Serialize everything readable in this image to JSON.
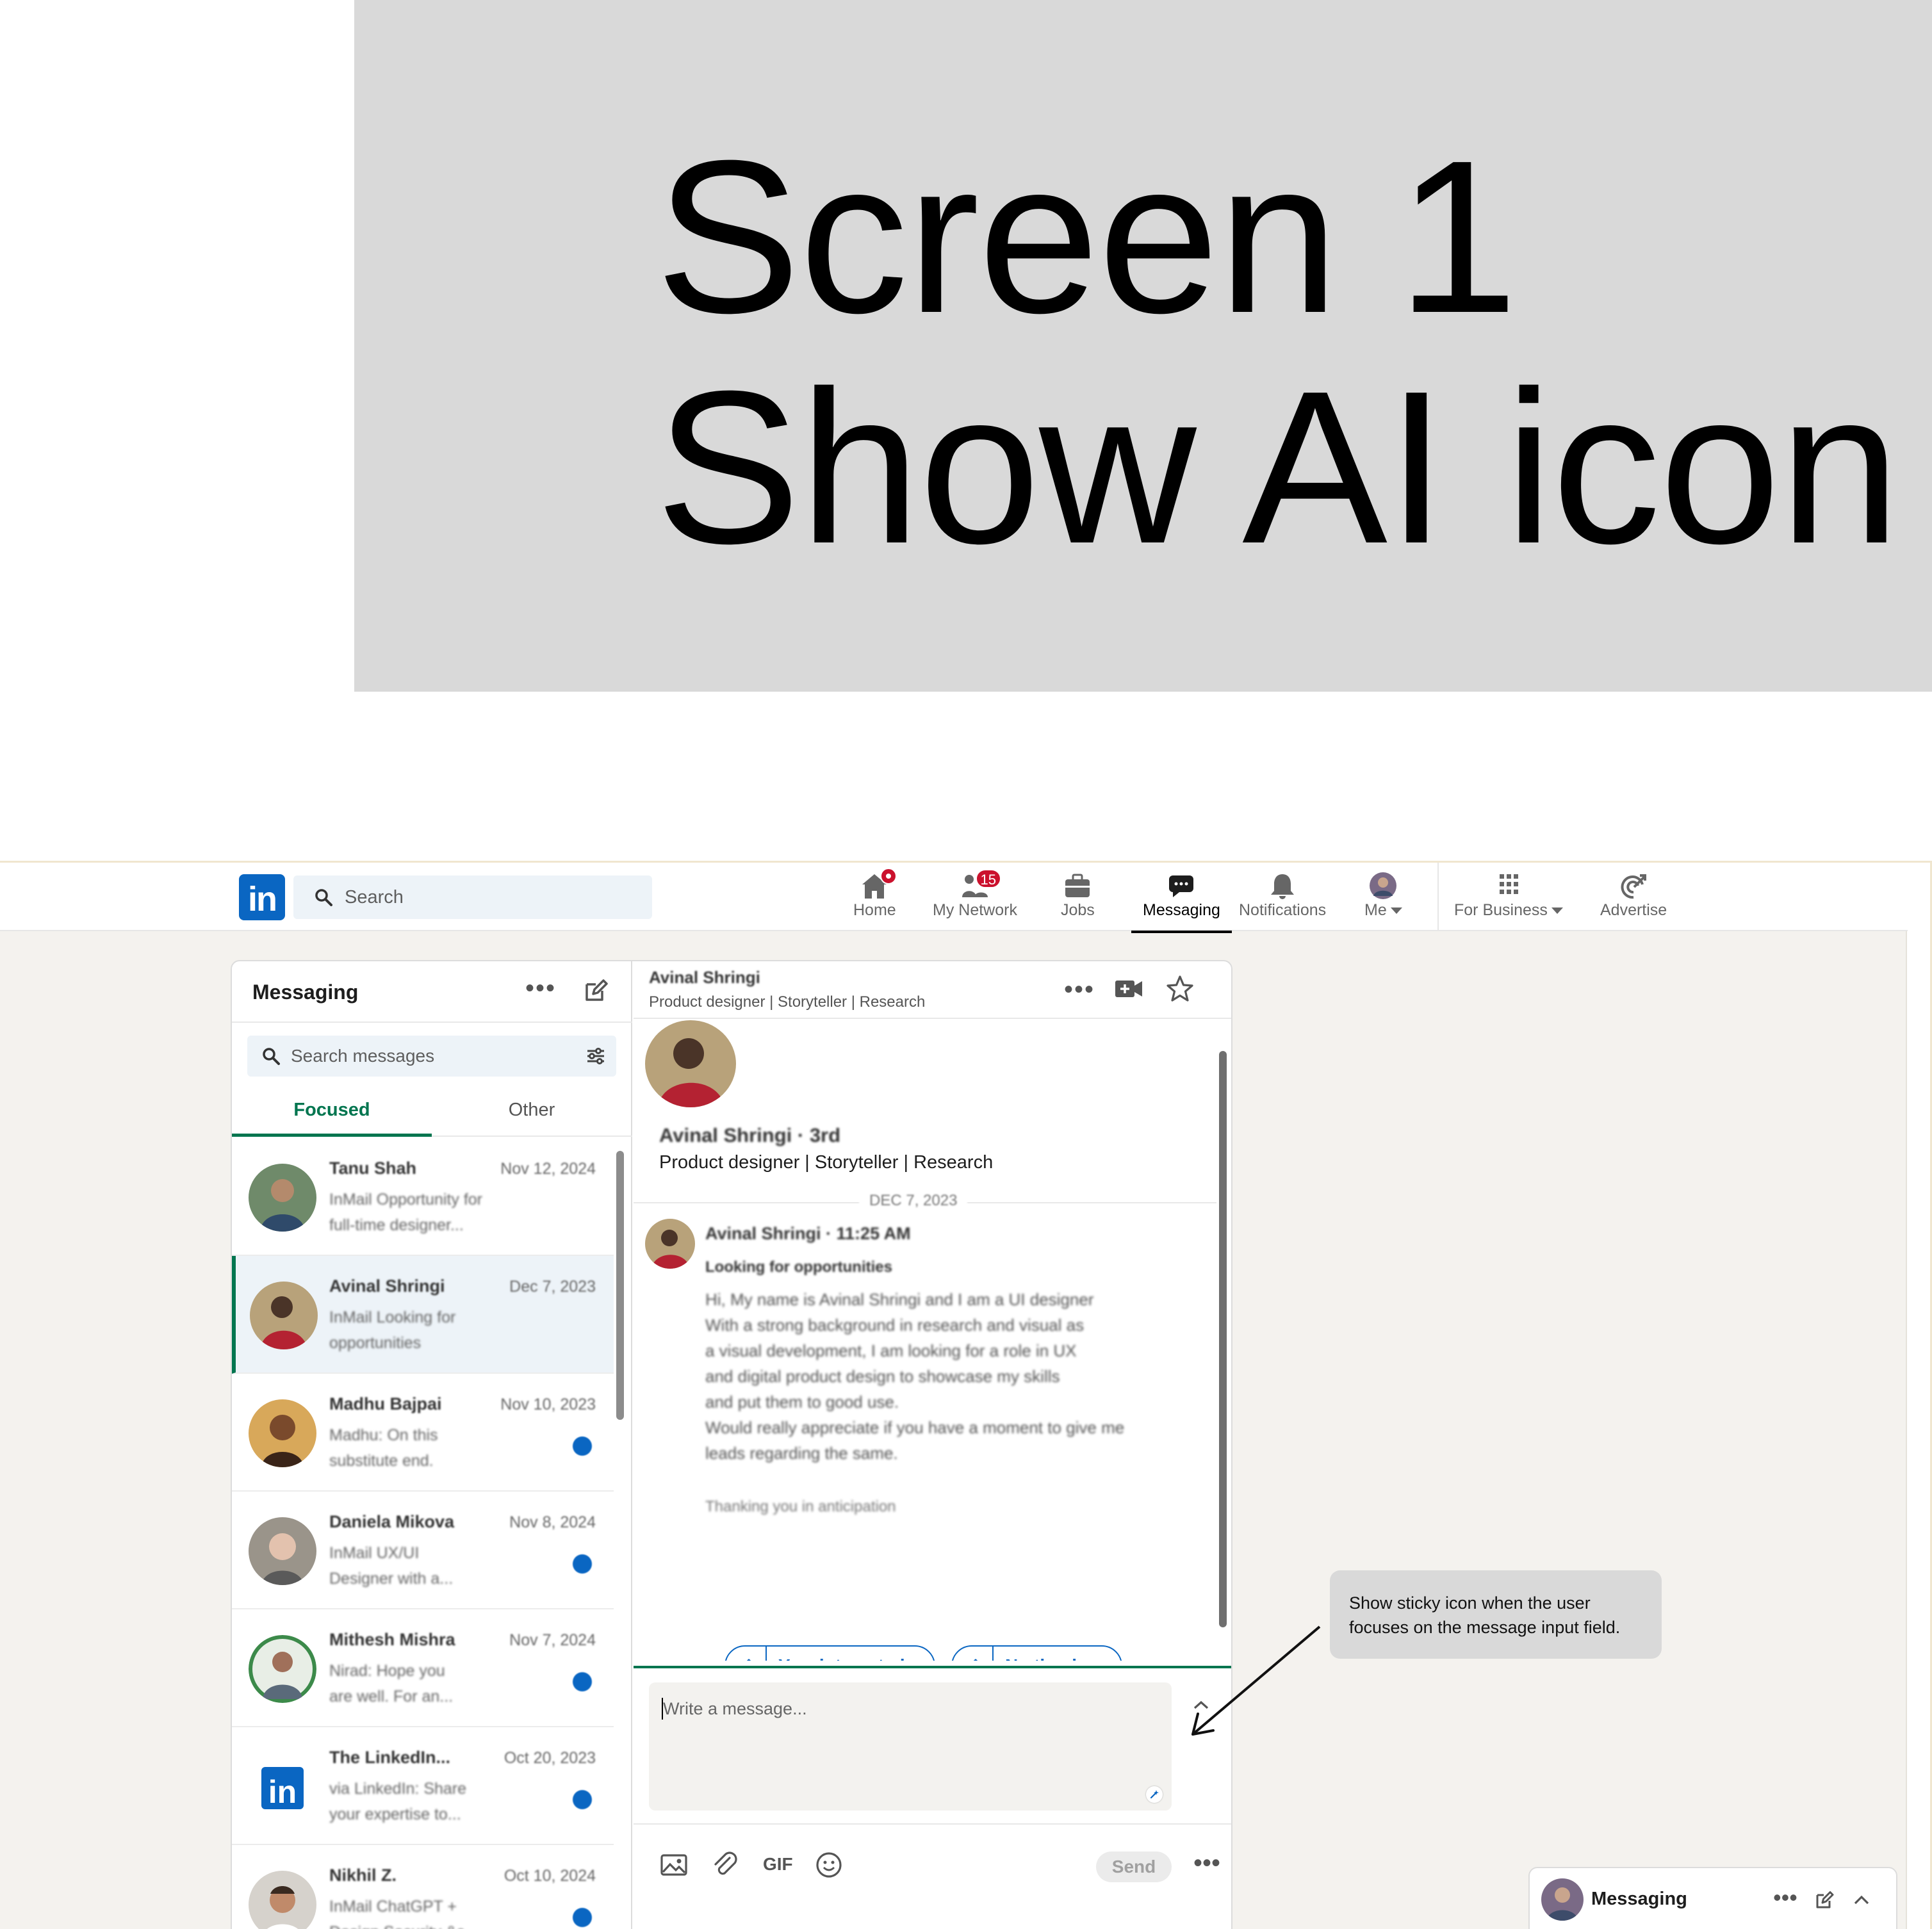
{
  "title_card": {
    "line1": "Screen 1",
    "line2": "Show AI icon"
  },
  "topnav": {
    "logo": "in",
    "search_placeholder": "Search",
    "items": [
      {
        "label": "Home",
        "icon": "home-icon",
        "badge": "dot"
      },
      {
        "label": "My Network",
        "icon": "network-icon",
        "badge": "15"
      },
      {
        "label": "Jobs",
        "icon": "briefcase-icon"
      },
      {
        "label": "Messaging",
        "icon": "messaging-icon",
        "active": true
      },
      {
        "label": "Notifications",
        "icon": "bell-icon"
      },
      {
        "label": "Me",
        "icon": "avatar"
      },
      {
        "label": "For Business",
        "icon": "grid-icon"
      },
      {
        "label": "Advertise",
        "icon": "advertise-icon"
      }
    ],
    "accent_color": "#0a66c2",
    "badge_color": "#cb112d"
  },
  "messaging": {
    "title": "Messaging",
    "search_placeholder": "Search messages",
    "tabs": {
      "focused": "Focused",
      "other": "Other"
    },
    "accent_color": "#01754f",
    "conversations": [
      {
        "name": "Tanu Shah",
        "date": "Nov 12, 2024",
        "snippet_line1": "InMail  Opportunity for",
        "snippet_line2": "full-time designer...",
        "unread": false
      },
      {
        "name": "Avinal Shringi",
        "date": "Dec 7, 2023",
        "snippet_line1": "InMail  Looking for",
        "snippet_line2": "opportunities",
        "unread": false,
        "selected": true
      },
      {
        "name": "Madhu Bajpai",
        "date": "Nov 10, 2023",
        "snippet_line1": "Madhu: On this",
        "snippet_line2": "substitute end.",
        "unread": true
      },
      {
        "name": "Daniela Mikova",
        "date": "Nov 8, 2024",
        "snippet_line1": "InMail  UX/UI",
        "snippet_line2": "Designer with a...",
        "unread": true
      },
      {
        "name": "Mithesh Mishra",
        "date": "Nov 7, 2024",
        "snippet_line1": "Nirad: Hope you",
        "snippet_line2": "are well. For an...",
        "unread": true
      },
      {
        "name": "The LinkedIn...",
        "date": "Oct 20, 2023",
        "snippet_line1": "via LinkedIn: Share",
        "snippet_line2": "your expertise to...",
        "unread": true
      },
      {
        "name": "Nikhil Z.",
        "date": "Oct 10, 2024",
        "snippet_line1": "InMail  ChatGPT +",
        "snippet_line2": "Design Security &c...",
        "unread": true
      }
    ]
  },
  "conversation": {
    "header_name": "Avinal Shringi",
    "header_subtitle": "Product designer | Storyteller | Research",
    "profile_name": "Avinal Shringi · 3rd",
    "profile_title": "Product designer | Storyteller | Research",
    "date_separator": "DEC 7, 2023",
    "sender_line": "Avinal Shringi · 11:25 AM",
    "subject": "Looking for opportunities",
    "body": [
      "Hi, My name is Avinal Shringi and I am a UI designer",
      "With a strong background in research and visual as",
      "a visual development, I am looking for a role in UX",
      "and digital product design to showcase my skills",
      "and put them to good use.",
      "Would really appreciate if you have a moment to give me",
      "leads regarding the same."
    ],
    "signature": "Thanking you in anticipation",
    "smart_replies": [
      "Yes, interested...",
      "No thanks..."
    ],
    "input_placeholder": "Write a message...",
    "gif_label": "GIF",
    "send_label": "Send"
  },
  "annotation": {
    "text": "Show sticky icon when the user focuses on the message input field."
  },
  "dock": {
    "label": "Messaging"
  }
}
